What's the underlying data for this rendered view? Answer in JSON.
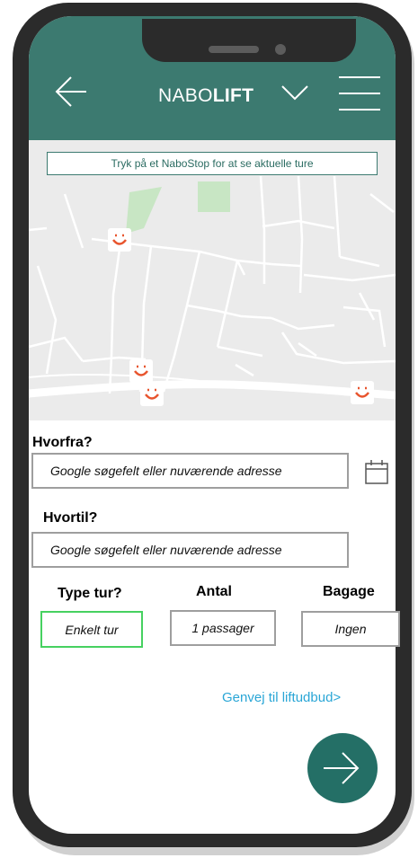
{
  "header": {
    "brand_regular": "NABO",
    "brand_bold": "LIFT",
    "back_icon": "arrow-left-icon",
    "dropdown_icon": "chevron-down-icon",
    "menu_icon": "hamburger-menu-icon",
    "color": "#3c7a70"
  },
  "map": {
    "banner": "Tryk på et NaboStop for at se aktuelle ture",
    "pin_icon": "nabostop-pin-icon",
    "pin_color": "#e8552e"
  },
  "form": {
    "from": {
      "label": "Hvorfra?",
      "placeholder": "Google søgefelt eller nuværende adresse",
      "calendar_icon": "calendar-icon"
    },
    "to": {
      "label": "Hvortil?",
      "placeholder": "Google søgefelt eller nuværende adresse"
    },
    "trip_type": {
      "label": "Type tur?",
      "value": "Enkelt tur"
    },
    "count": {
      "label": "Antal",
      "value": "1 passager"
    },
    "luggage": {
      "label": "Bagage",
      "value": "Ingen"
    }
  },
  "shortcut_link": "Genvej til liftudbud>",
  "next_button": {
    "icon": "arrow-right-icon",
    "color": "#246f66"
  }
}
